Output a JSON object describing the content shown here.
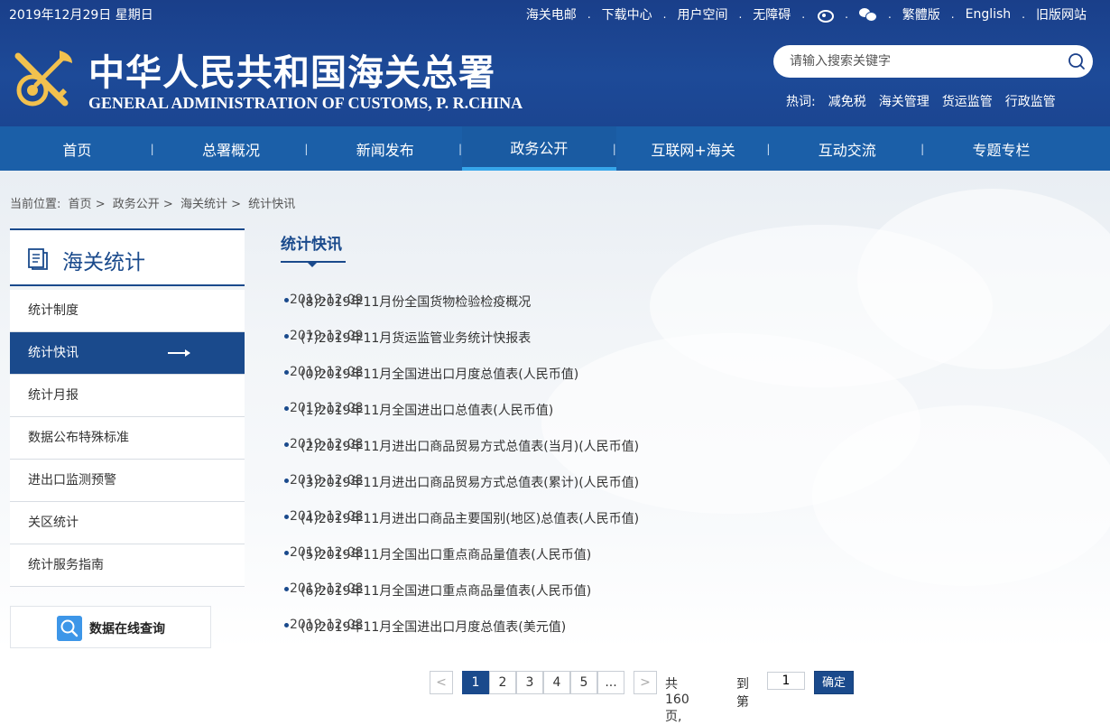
{
  "topbar": {
    "date": "2019年12月29日 星期日",
    "links": [
      "海关电邮",
      "下载中心",
      "用户空间",
      "无障碍",
      "繁體版",
      "English",
      "旧版网站"
    ],
    "icons": [
      "weibo-icon",
      "wechat-icon"
    ]
  },
  "header": {
    "site_name_cn": "中华人民共和国海关总署",
    "site_name_en": "GENERAL ADMINISTRATION OF CUSTOMS, P. R.CHINA",
    "search_placeholder": "请输入搜索关键字",
    "hot_label": "热词:",
    "hot_words": [
      "减免税",
      "海关管理",
      "货运监管",
      "行政监管"
    ]
  },
  "nav": {
    "items": [
      "首页",
      "总署概况",
      "新闻发布",
      "政务公开",
      "互联网+海关",
      "互动交流",
      "专题专栏"
    ],
    "active_index": 3
  },
  "breadcrumb": {
    "label": "当前位置:",
    "items": [
      "首页",
      "政务公开",
      "海关统计",
      "统计快讯"
    ],
    "separator": ">"
  },
  "sidebar": {
    "title": "海关统计",
    "items": [
      "统计制度",
      "统计快讯",
      "统计月报",
      "数据公布特殊标准",
      "进出口监测预警",
      "关区统计",
      "统计服务指南"
    ],
    "active_index": 1,
    "data_query_label": "数据在线查询"
  },
  "main": {
    "title": "统计快讯",
    "items": [
      {
        "title": "(8)2019年11月份全国货物检验检疫概况",
        "date": "2019-12-09"
      },
      {
        "title": "(7)2019年11月货运监管业务统计快报表",
        "date": "2019-12-09"
      },
      {
        "title": "(0)2019年11月全国进出口月度总值表(人民币值)",
        "date": "2019-12-08"
      },
      {
        "title": "(1)2019年11月全国进出口总值表(人民币值)",
        "date": "2019-12-08"
      },
      {
        "title": "(2)2019年11月进出口商品贸易方式总值表(当月)(人民币值)",
        "date": "2019-12-08"
      },
      {
        "title": "(3)2019年11月进出口商品贸易方式总值表(累计)(人民币值)",
        "date": "2019-12-08"
      },
      {
        "title": "(4)2019年11月进出口商品主要国别(地区)总值表(人民币值)",
        "date": "2019-12-08"
      },
      {
        "title": "(5)2019年11月全国出口重点商品量值表(人民币值)",
        "date": "2019-12-08"
      },
      {
        "title": "(6)2019年11月全国进口重点商品量值表(人民币值)",
        "date": "2019-12-08"
      },
      {
        "title": "(0)2019年11月全国进出口月度总值表(美元值)",
        "date": "2019-12-08"
      }
    ]
  },
  "pagination": {
    "prev": "<",
    "pages": [
      "1",
      "2",
      "3",
      "4",
      "5",
      "..."
    ],
    "current": "1",
    "next": ">",
    "total_text": "共 160页,",
    "goto_label": "到第",
    "input_value": "1",
    "confirm_label": "确定"
  },
  "colors": {
    "header_blue": "#1d4a98",
    "nav_blue": "#1b5fa8",
    "accent": "#1a4a8c",
    "active_underline": "#37a6ea"
  }
}
